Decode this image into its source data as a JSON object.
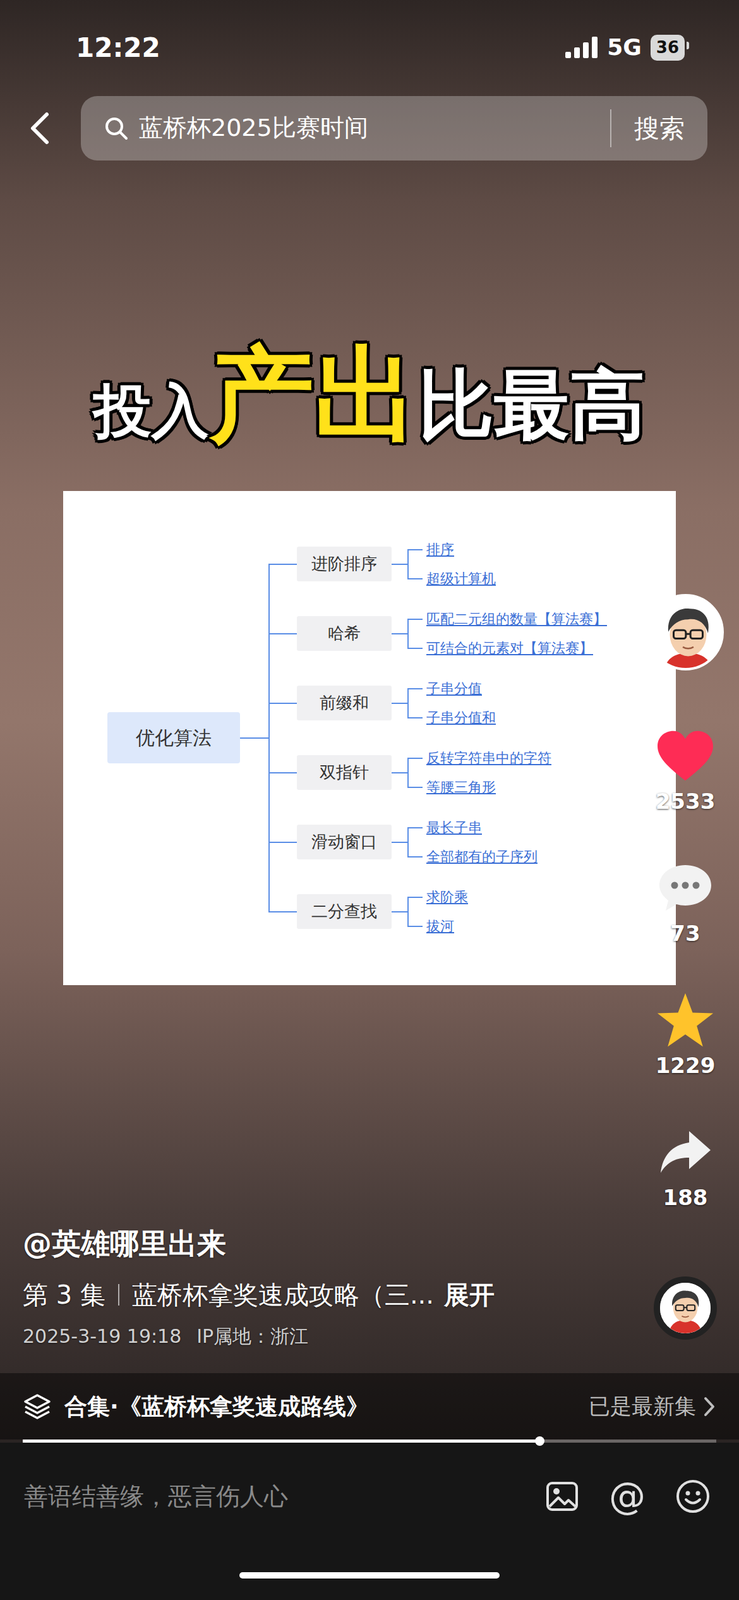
{
  "status_bar": {
    "time": "12:22",
    "network": "5G",
    "battery": "36"
  },
  "search": {
    "query": "蓝桥杯2025比赛时间",
    "button": "搜索"
  },
  "video": {
    "caption": [
      {
        "text": "投入",
        "highlight": false
      },
      {
        "text": "产出",
        "highlight": true
      },
      {
        "text": "比最高",
        "highlight": false
      }
    ],
    "mindmap": {
      "root": "优化算法",
      "branches": [
        {
          "label": "进阶排序",
          "leaves": [
            "排序",
            "超级计算机"
          ]
        },
        {
          "label": "哈希",
          "leaves": [
            "匹配二元组的数量【算法赛】",
            "可结合的元素对【算法赛】"
          ]
        },
        {
          "label": "前缀和",
          "leaves": [
            "子串分值",
            "子串分值和"
          ]
        },
        {
          "label": "双指针",
          "leaves": [
            "反转字符串中的字符",
            "等腰三角形"
          ]
        },
        {
          "label": "滑动窗口",
          "leaves": [
            "最长子串",
            "全部都有的子序列"
          ]
        },
        {
          "label": "二分查找",
          "leaves": [
            "求阶乘",
            "拔河"
          ]
        }
      ]
    }
  },
  "actions": [
    {
      "kind": "heart",
      "count": "2533",
      "active": true
    },
    {
      "kind": "comment",
      "count": "73",
      "active": false
    },
    {
      "kind": "star",
      "count": "1229",
      "active": true
    },
    {
      "kind": "share",
      "count": "188",
      "active": false
    }
  ],
  "info": {
    "author": "@英雄哪里出来",
    "episode": "第 3 集",
    "title": "蓝桥杯拿奖速成攻略（三...",
    "expand": "展开",
    "date": "2025-3-19 19:18",
    "ip": "IP属地：浙江"
  },
  "collection": {
    "label": "合集·《蓝桥杯拿奖速成路线》",
    "status": "已是最新集"
  },
  "progress": {
    "level": 0.745
  },
  "comment_bar": {
    "placeholder": "善语结善缘，恶言伤人心",
    "mention": "@"
  }
}
